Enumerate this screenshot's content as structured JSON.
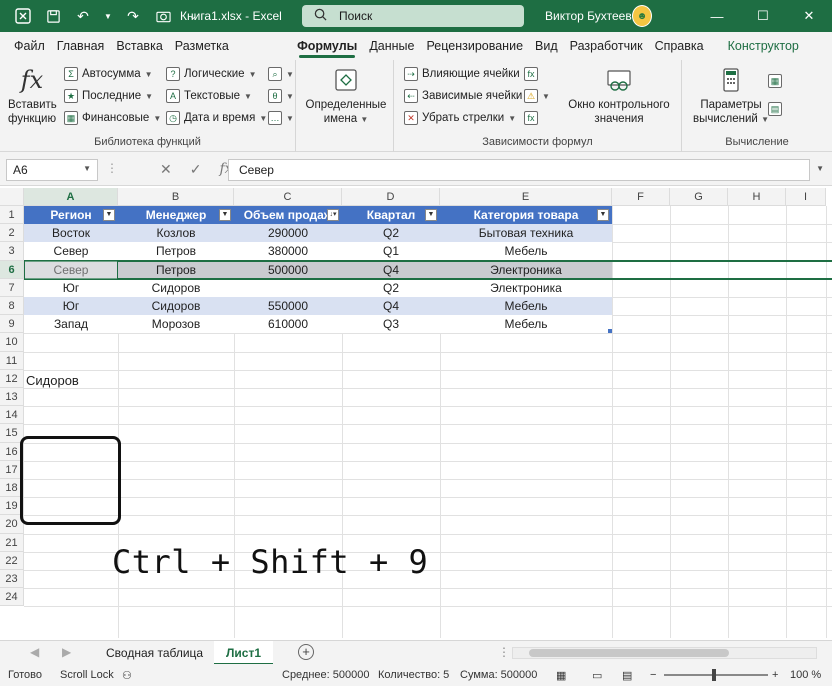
{
  "titlebar": {
    "filename": "Книга1.xlsx",
    "separator": "-",
    "app": "Excel",
    "search_placeholder": "Поиск",
    "user": "Виктор Бухтеев"
  },
  "tabs": [
    "Файл",
    "Главная",
    "Вставка",
    "Разметка страницы",
    "Формулы",
    "Данные",
    "Рецензирование",
    "Вид",
    "Разработчик",
    "Справка",
    "Конструктор табл"
  ],
  "active_tab": "Формулы",
  "ribbon": {
    "insert_function": "Вставить функцию",
    "insert_function_l1": "Вставить",
    "insert_function_l2": "функцию",
    "autosum": "Автосумма",
    "recent": "Последние",
    "financial": "Финансовые",
    "logical": "Логические",
    "text": "Текстовые",
    "datetime": "Дата и время",
    "lib_label": "Библиотека функций",
    "defined_names_l1": "Определенные",
    "defined_names_l2": "имена",
    "trace_precedents": "Влияющие ячейки",
    "trace_dependents": "Зависимые ячейки",
    "remove_arrows": "Убрать стрелки",
    "watch_l1": "Окно контрольного",
    "watch_l2": "значения",
    "audit_label": "Зависимости формул",
    "calc_l1": "Параметры",
    "calc_l2": "вычислений",
    "calc_label": "Вычисление"
  },
  "formula_bar": {
    "name_box": "A6",
    "fx": "fx",
    "value": "Север"
  },
  "columns": [
    "A",
    "B",
    "C",
    "D",
    "E",
    "F",
    "G",
    "H",
    "I"
  ],
  "rows": [
    "1",
    "2",
    "3",
    "6",
    "7",
    "8",
    "9",
    "10",
    "11",
    "12",
    "13",
    "14",
    "15",
    "16",
    "17",
    "18",
    "19",
    "20",
    "21",
    "22",
    "23",
    "24"
  ],
  "table": {
    "headers": [
      "Регион",
      "Менеджер",
      "Объем продаж",
      "Квартал",
      "Категория товара"
    ],
    "rows": [
      [
        "Восток",
        "Козлов",
        "290000",
        "Q2",
        "Бытовая техника"
      ],
      [
        "Север",
        "Петров",
        "380000",
        "Q1",
        "Мебель"
      ],
      [
        "Север",
        "Петров",
        "500000",
        "Q4",
        "Электроника"
      ],
      [
        "Юг",
        "Сидоров",
        "",
        "Q2",
        "Электроника"
      ],
      [
        "Юг",
        "Сидоров",
        "550000",
        "Q4",
        "Мебель"
      ],
      [
        "Запад",
        "Морозов",
        "610000",
        "Q3",
        "Мебель"
      ]
    ]
  },
  "cell_a12": "Сидоров",
  "annotation": "Ctrl + Shift + 9",
  "sheets": [
    "Сводная таблица",
    "Лист1"
  ],
  "active_sheet": "Лист1",
  "status": {
    "ready": "Готово",
    "scroll_lock": "Scroll Lock",
    "average": "Среднее: 500000",
    "count": "Количество: 5",
    "sum": "Сумма: 500000",
    "zoom": "100 %"
  },
  "colors": {
    "excel_green": "#1e6e43",
    "table_header": "#4472c4",
    "band": "#d9e1f2"
  }
}
